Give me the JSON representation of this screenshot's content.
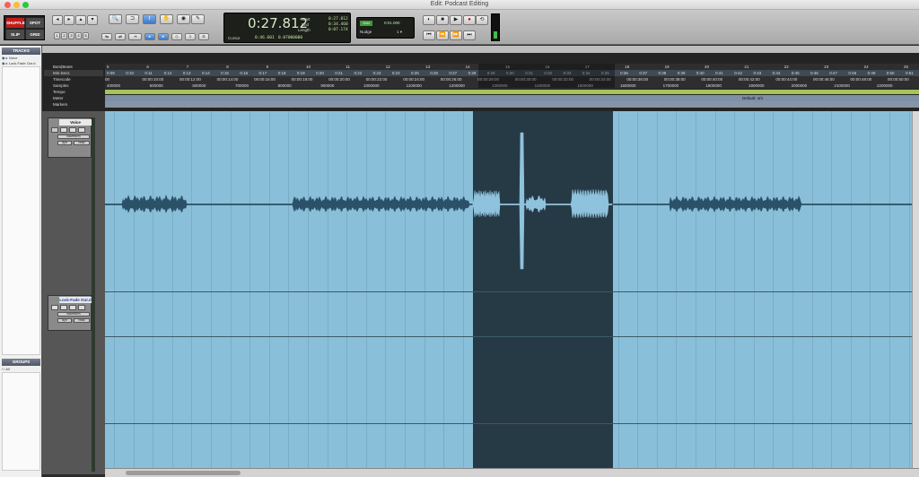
{
  "window": {
    "title": "Edit: Podcast Editing"
  },
  "toolbar": {
    "modes": [
      "SHUFFLE",
      "SPOT",
      "SLIP",
      "GRID"
    ],
    "counter": {
      "main": "0:27.812",
      "start_label": "Start",
      "start": "0:27.812",
      "end_label": "End",
      "end": "0:34.460",
      "length_label": "Length",
      "length": "0:07.174",
      "cursor_label": "Cursor",
      "cursor": "0:46.601",
      "cursor_value": "0.07000000"
    },
    "grid": {
      "label": "Grid",
      "value": "0:01.000"
    },
    "nudge": {
      "label": "Nudge",
      "value": "1 ▾"
    }
  },
  "sidebar": {
    "tracks_title": "TRACKS",
    "tracks": [
      "Voice",
      "Lock-Fade Out.d"
    ],
    "groups_title": "GROUPS",
    "groups": [
      "!  ! All"
    ]
  },
  "rulers": {
    "labels": [
      "Bars|Beats",
      "Min:Secs",
      "Timecode",
      "Samples",
      "Tempo",
      "Meter",
      "Markers"
    ],
    "bars": [
      "5",
      "6",
      "7",
      "8",
      "9",
      "10",
      "11",
      "12",
      "13",
      "14",
      "15",
      "16",
      "17",
      "18",
      "19",
      "20",
      "21",
      "22",
      "23",
      "24",
      "25"
    ],
    "minsecs": [
      "0:09",
      "0:10",
      "0:11",
      "0:12",
      "0:13",
      "0:14",
      "0:15",
      "0:16",
      "0:17",
      "0:18",
      "0:19",
      "0:20",
      "0:21",
      "0:22",
      "0:23",
      "0:24",
      "0:25",
      "0:26",
      "0:27",
      "0:28",
      "0:29",
      "0:30",
      "0:31",
      "0:32",
      "0:33",
      "0:34",
      "0:35",
      "0:36",
      "0:37",
      "0:38",
      "0:39",
      "0:40",
      "0:41",
      "0:42",
      "0:43",
      "0:44",
      "0:45",
      "0:46",
      "0:47",
      "0:48",
      "0:49",
      "0:50",
      "0:51"
    ],
    "timecode": [
      "00",
      "00:00:10:00",
      "00:00:12:00",
      "00:00:14:00",
      "00:00:16:00",
      "00:00:18:00",
      "00:00:20:00",
      "00:00:22:00",
      "00:00:24:00",
      "00:00:26:00",
      "00:00:28:00",
      "00:00:30:00",
      "00:00:32:00",
      "00:00:34:00",
      "00:00:36:00",
      "00:00:38:00",
      "00:00:40:00",
      "00:00:42:00",
      "00:00:44:00",
      "00:00:46:00",
      "00:00:48:00",
      "00:00:50:00"
    ],
    "samples": [
      "400000",
      "500000",
      "600000",
      "700000",
      "800000",
      "900000",
      "1000000",
      "1100000",
      "1200000",
      "1300000",
      "1400000",
      "1500000",
      "1600000",
      "1700000",
      "1800000",
      "1900000",
      "2000000",
      "2100000",
      "2200000"
    ],
    "meter_marker": "Default: 4/4"
  },
  "tracks": [
    {
      "name": "Voice",
      "pick": "waveform",
      "sub": "dyn",
      "vol": "read"
    },
    {
      "name": "Lock-Fade Out.d",
      "pick": "waveform",
      "sub": "dyn",
      "vol": "read"
    }
  ]
}
